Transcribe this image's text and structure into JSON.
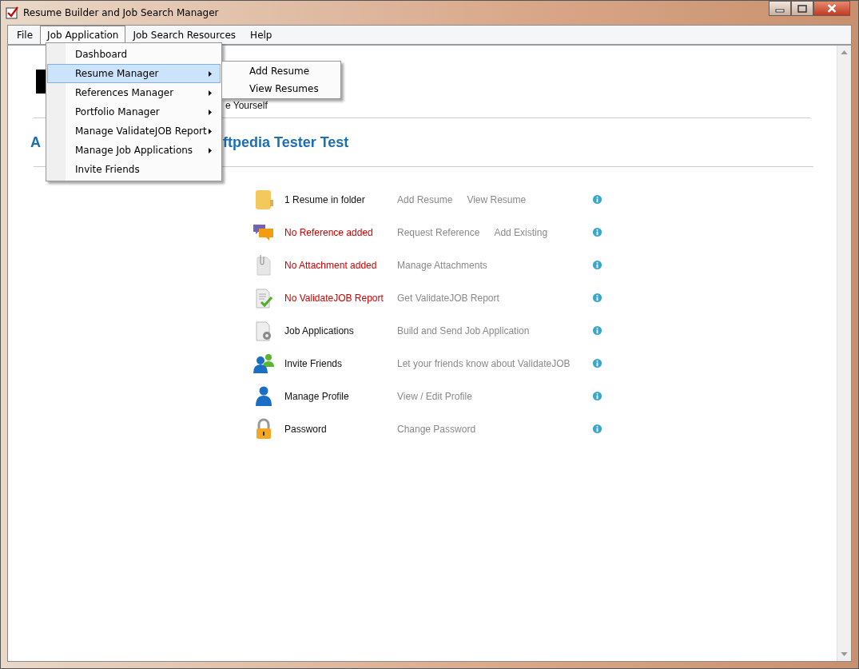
{
  "window": {
    "title": "Resume Builder and Job Search Manager"
  },
  "menu_bar": [
    {
      "label": "File",
      "selected": false
    },
    {
      "label": "Job Application",
      "selected": true
    },
    {
      "label": "Job Search Resources",
      "selected": false
    },
    {
      "label": "Help",
      "selected": false
    }
  ],
  "dropdown": {
    "items": [
      {
        "label": "Dashboard",
        "selected": false,
        "has_submenu": false
      },
      {
        "label": "Resume Manager",
        "selected": true,
        "has_submenu": true
      },
      {
        "label": "References Manager",
        "selected": false,
        "has_submenu": true
      },
      {
        "label": "Portfolio Manager",
        "selected": false,
        "has_submenu": true
      },
      {
        "label": "Manage ValidateJOB Report",
        "selected": false,
        "has_submenu": true
      },
      {
        "label": "Manage Job Applications",
        "selected": false,
        "has_submenu": true
      },
      {
        "label": "Invite Friends",
        "selected": false,
        "has_submenu": false
      }
    ],
    "submenu": [
      "Add Resume",
      "View Resumes"
    ]
  },
  "header": {
    "tagline": "e Yourself",
    "greeting_start": "A",
    "greeting_end": "ftpedia Tester Test"
  },
  "rows": [
    {
      "kind": "folder",
      "status": "1 Resume in folder",
      "missing": false,
      "actions": [
        "Add Resume",
        "View Resume"
      ]
    },
    {
      "kind": "chat",
      "status": "No Reference added",
      "missing": true,
      "actions": [
        "Request Reference",
        "Add Existing"
      ]
    },
    {
      "kind": "attachment",
      "status": "No Attachment added",
      "missing": true,
      "actions": [
        "Manage Attachments"
      ]
    },
    {
      "kind": "report",
      "status": "No ValidateJOB Report",
      "missing": true,
      "actions": [
        "Get ValidateJOB Report"
      ]
    },
    {
      "kind": "application",
      "status": "Job Applications",
      "missing": false,
      "actions": [
        "Build and Send Job Application"
      ]
    },
    {
      "kind": "friends",
      "status": "Invite Friends",
      "missing": false,
      "actions": [
        "Let your friends know about ValidateJOB"
      ]
    },
    {
      "kind": "profile",
      "status": "Manage Profile",
      "missing": false,
      "actions": [
        "View / Edit Profile"
      ]
    },
    {
      "kind": "password",
      "status": "Password",
      "missing": false,
      "actions": [
        "Change Password"
      ]
    }
  ]
}
